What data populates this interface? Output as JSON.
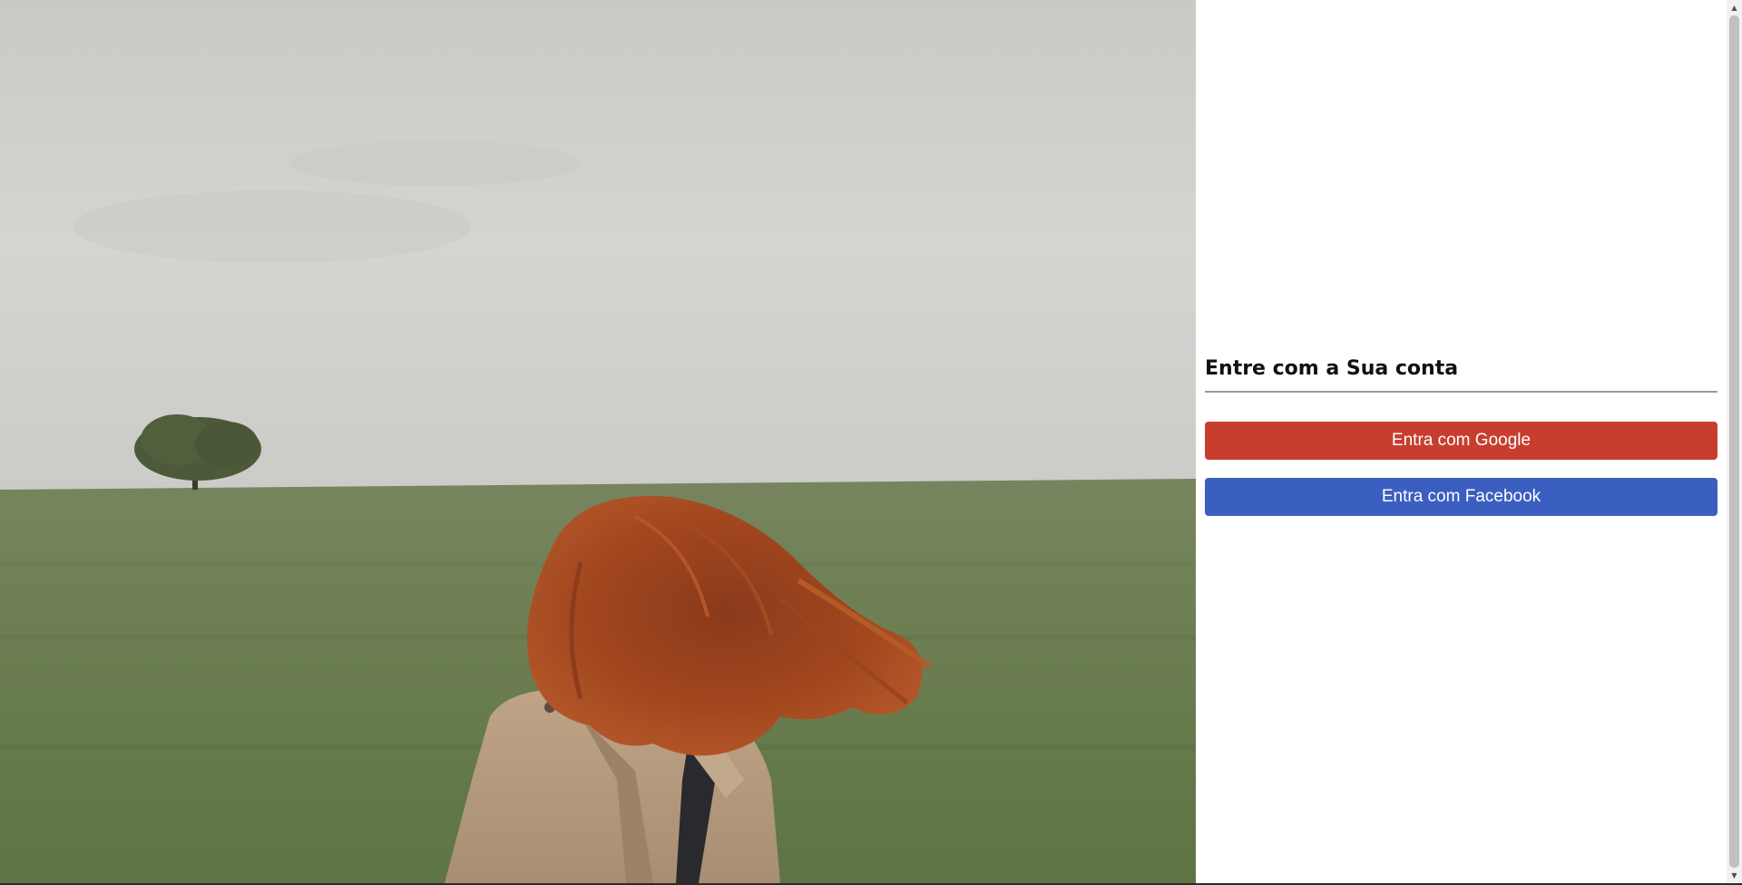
{
  "hero": {
    "image_name": "woman-curly-red-hair-beige-trench-coat-in-green-field-with-tree"
  },
  "login": {
    "title": "Entre com a Sua conta",
    "google_button": "Entra com Google",
    "facebook_button": "Entra com Facebook"
  },
  "colors": {
    "google": "#c73e2f",
    "facebook": "#3b5ec1",
    "divider": "#9a9a9a"
  },
  "scrollbar": {
    "up_icon": "chevron-up-icon",
    "down_icon": "chevron-down-icon"
  }
}
